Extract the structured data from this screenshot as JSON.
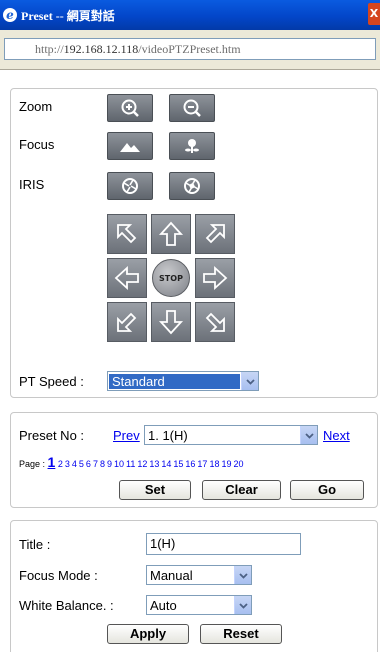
{
  "window": {
    "title": "Preset -- 網頁對話",
    "close": "X"
  },
  "address": {
    "host": "http://192.168.12.118/videoPTZPreset.htm"
  },
  "camera": {
    "zoom_label": "Zoom",
    "focus_label": "Focus",
    "iris_label": "IRIS",
    "stop_label": "STOP",
    "pt_speed_label": "PT Speed :",
    "pt_speed_value": "Standard"
  },
  "preset": {
    "label": "Preset No :",
    "prev": "Prev",
    "value": "1. 1(H)",
    "next": "Next",
    "page_label": "Page :",
    "current_page": "1",
    "pages": [
      "2",
      "3",
      "4",
      "5",
      "6",
      "7",
      "8",
      "9",
      "10",
      "11",
      "12",
      "13",
      "14",
      "15",
      "16",
      "17",
      "18",
      "19",
      "20"
    ],
    "set": "Set",
    "clear": "Clear",
    "go": "Go"
  },
  "settings": {
    "title_label": "Title :",
    "title_value": "1(H)",
    "focus_mode_label": "Focus Mode :",
    "focus_mode_value": "Manual",
    "wb_label": "White Balance. :",
    "wb_value": "Auto",
    "apply": "Apply",
    "reset": "Reset"
  }
}
